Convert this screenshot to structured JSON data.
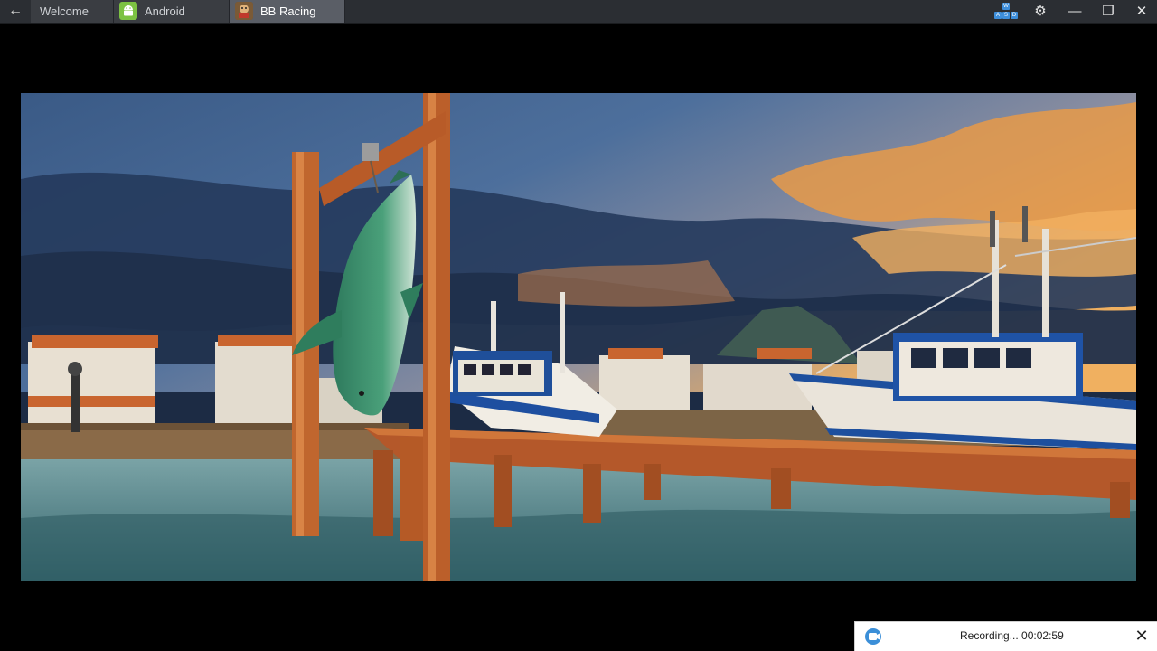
{
  "window": {
    "back_glyph": "←",
    "tabs": [
      {
        "label": "Welcome",
        "active": false
      },
      {
        "label": "Android",
        "active": false,
        "icon": "android-icon"
      },
      {
        "label": "BB Racing",
        "active": true,
        "icon": "bb-racing-game-icon"
      }
    ],
    "controls": {
      "keymap_icon": "wasd-keyboard-icon",
      "keymap_keys": [
        "W",
        "A",
        "S",
        "D"
      ],
      "settings_glyph": "⚙",
      "minimize_glyph": "—",
      "restore_glyph": "❐",
      "close_glyph": "✕"
    }
  },
  "game": {
    "scene": "harbor-dock-with-hanging-fish-and-fishing-boats",
    "sky_colors": [
      "#2f4a73",
      "#e8a04a"
    ],
    "water_color": "#4f7d86",
    "dock_color": "#b4582a"
  },
  "recording": {
    "icon": "video-camera-icon",
    "status": "Recording... 00:02:59",
    "close_glyph": "✕"
  },
  "colors": {
    "titlebar": "#2b2e33",
    "active_tab": "#5a5e66",
    "accent": "#3d8edb"
  }
}
